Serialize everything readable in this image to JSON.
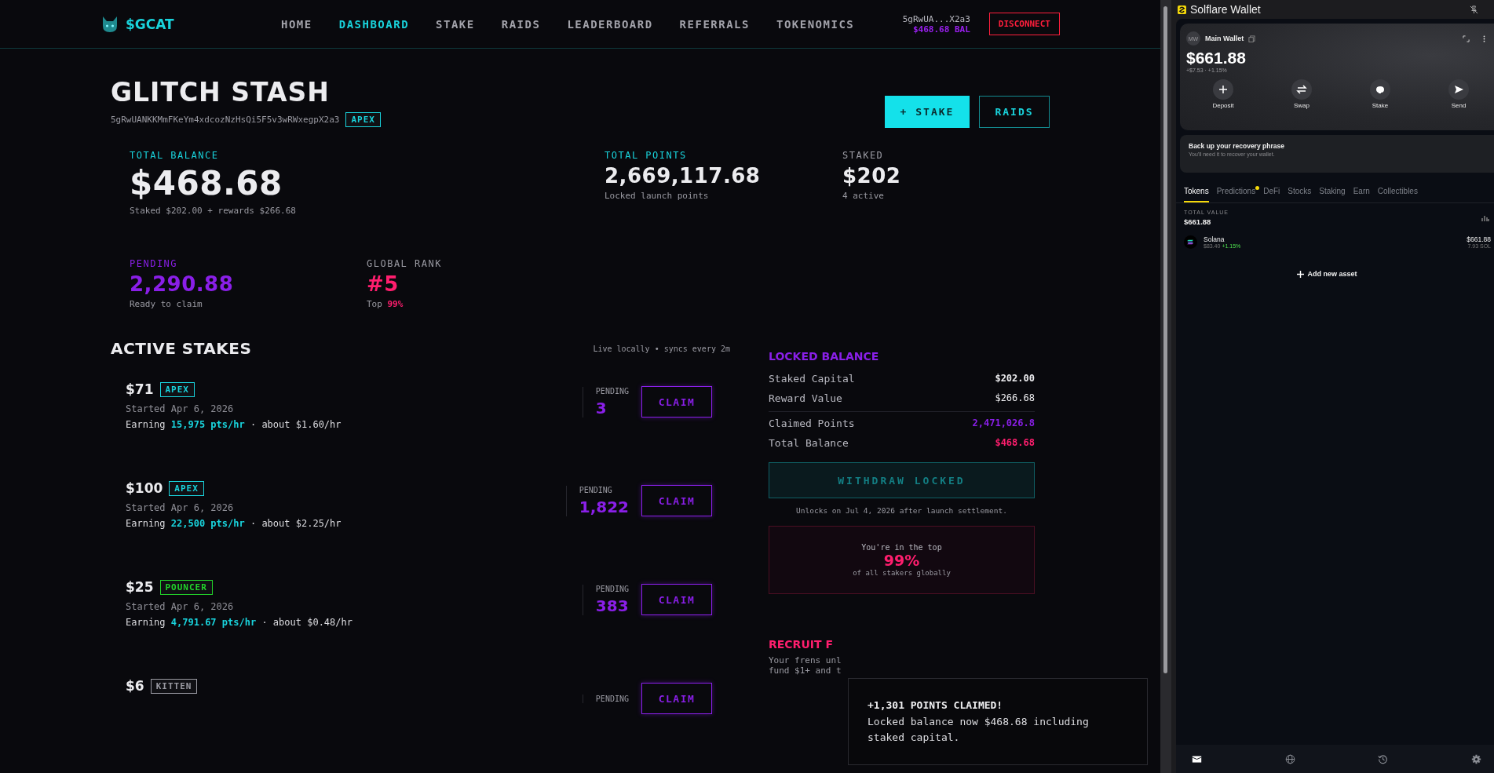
{
  "nav": {
    "logo": "$GCAT",
    "items": [
      {
        "label": "HOME",
        "selected": false
      },
      {
        "label": "DASHBOARD",
        "selected": true
      },
      {
        "label": "STAKE",
        "selected": false
      },
      {
        "label": "RAIDS",
        "selected": false
      },
      {
        "label": "LEADERBOARD",
        "selected": false
      },
      {
        "label": "REFERRALS",
        "selected": false
      },
      {
        "label": "TOKENOMICS",
        "selected": false
      }
    ],
    "wallet_address": "5gRwUA...X2a3",
    "balance": "$468.68 BAL",
    "disconnect": "DISCONNECT"
  },
  "profile": {
    "title": "GLITCH STASH",
    "address": "5gRwUANKKMmFKeYm4xdcozNzHsQi5F5v3wRWxegpX2a3",
    "tier": "APEX",
    "buttons": [
      {
        "label": "+ STAKE",
        "kind": "primary"
      },
      {
        "label": "RAIDS",
        "kind": "outline"
      }
    ]
  },
  "stats_rows": [
    [
      {
        "kind": "balance",
        "label": "TOTAL BALANCE",
        "value": "$468.68",
        "note": "Staked $202.00 + rewards $266.68"
      },
      {
        "kind": "points",
        "label": "TOTAL POINTS",
        "value": "2,669,117.68",
        "note": "Locked launch points"
      },
      {
        "kind": "staked",
        "label": "STAKED",
        "value": "$202",
        "note": "4 active"
      }
    ],
    [
      {
        "kind": "pending",
        "label": "PENDING",
        "value": "2,290.88",
        "note": "Ready to claim"
      },
      {
        "kind": "rank",
        "label": "GLOBAL RANK",
        "value": "#5",
        "note": "Top **99%**"
      }
    ]
  ],
  "stakes": {
    "title": "ACTIVE STAKES",
    "sync": "Live locally • syncs every 2m",
    "items": [
      {
        "amount": "$71",
        "tier": "APEX",
        "color": "#19d3dc",
        "started": "Started Apr 6, 2026",
        "earning": "Earning **15,975 pts/hr** · about $1.60/hr",
        "pending_label": "PENDING",
        "pending": "3",
        "claim": "CLAIM"
      },
      {
        "amount": "$100",
        "tier": "APEX",
        "color": "#19d3dc",
        "started": "Started Apr 6, 2026",
        "earning": "Earning **22,500 pts/hr** · about $2.25/hr",
        "pending_label": "PENDING",
        "pending": "1,822",
        "claim": "CLAIM"
      },
      {
        "amount": "$25",
        "tier": "POUNCER",
        "color": "#22d32a",
        "started": "Started Apr 6, 2026",
        "earning": "Earning **4,791.67 pts/hr** · about $0.48/hr",
        "pending_label": "PENDING",
        "pending": "383",
        "claim": "CLAIM"
      },
      {
        "amount": "$6",
        "tier": "KITTEN",
        "color": "#9a9aa2",
        "pending_label": "PENDING",
        "claim": "CLAIM"
      }
    ]
  },
  "locked": {
    "title": "LOCKED BALANCE",
    "rows": [
      {
        "kind": "capital",
        "label": "Staked Capital",
        "value": "$202.00"
      },
      {
        "kind": "reward",
        "label": "Reward Value",
        "value": "$266.68"
      },
      {
        "kind": "points",
        "label": "Claimed Points",
        "value": "2,471,026.8"
      },
      {
        "kind": "total",
        "label": "Total Balance",
        "value": "$468.68"
      }
    ],
    "withdraw": {
      "label": "WITHDRAW LOCKED",
      "disabled": true
    },
    "unlock_note": "Unlocks on Jul 4, 2026 after launch settlement.",
    "rank_box": {
      "lead": "You're in the top",
      "value": "99%",
      "tail": "of all stakers globally"
    }
  },
  "recruit": {
    "title": "RECRUIT F",
    "lines": [
      "Your frens unl",
      "fund $1+ and t"
    ]
  },
  "toast": {
    "title": "+1,301 POINTS CLAIMED!",
    "message": "Locked balance now $468.68 including staked capital."
  },
  "wallet": {
    "title": "Solflare Wallet",
    "initials": "MW",
    "account": "Main Wallet",
    "balance": "$661.88",
    "change": "+$7.53 · +1.15%",
    "actions": [
      {
        "kind": "deposit",
        "label": "Deposit"
      },
      {
        "kind": "swap",
        "label": "Swap"
      },
      {
        "kind": "stake",
        "label": "Stake"
      },
      {
        "kind": "send",
        "label": "Send"
      }
    ],
    "backup_title": "Back up your recovery phrase",
    "backup_text": "You'll need it to recover your wallet.",
    "tabs": [
      {
        "label": "Tokens",
        "selected": true,
        "dot": false
      },
      {
        "label": "Predictions",
        "selected": false,
        "dot": true
      },
      {
        "label": "DeFi",
        "selected": false,
        "dot": false
      },
      {
        "label": "Stocks",
        "selected": false,
        "dot": false
      },
      {
        "label": "Staking",
        "selected": false,
        "dot": false
      },
      {
        "label": "Earn",
        "selected": false,
        "dot": false
      },
      {
        "label": "Collectibles",
        "selected": false,
        "dot": false
      }
    ],
    "total_label": "TOTAL VALUE",
    "total": "$661.88",
    "assets": [
      {
        "name": "Solana",
        "price": "$83.40",
        "change": "+1.15%",
        "value": "$661.88",
        "amount": "7.93 SOL"
      }
    ],
    "add_asset": "Add new asset",
    "bottom_nav": [
      {
        "kind": "wallet",
        "selected": true
      },
      {
        "kind": "globe",
        "selected": false
      },
      {
        "kind": "history",
        "selected": false
      },
      {
        "kind": "settings",
        "selected": false
      }
    ]
  }
}
